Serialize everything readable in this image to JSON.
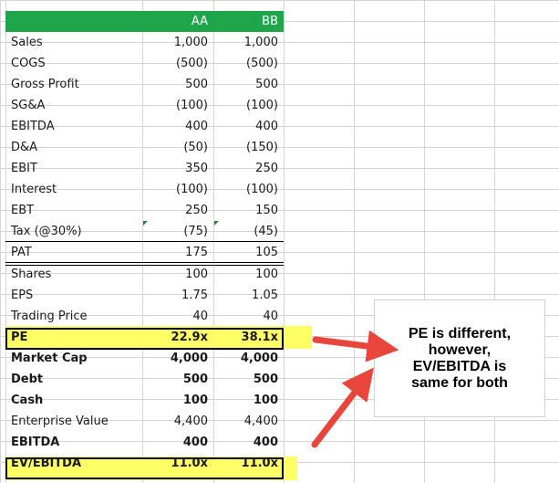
{
  "table": {
    "header": {
      "label": "",
      "aa": "AA",
      "bb": "BB"
    },
    "rows": [
      {
        "label": "Sales",
        "aa": "1,000",
        "bb": "1,000",
        "bold": false
      },
      {
        "label": "COGS",
        "aa": "(500)",
        "bb": "(500)",
        "bold": false
      },
      {
        "label": "Gross Profit",
        "aa": "500",
        "bb": "500",
        "bold": false
      },
      {
        "label": "SG&A",
        "aa": "(100)",
        "bb": "(100)",
        "bold": false
      },
      {
        "label": "EBITDA",
        "aa": "400",
        "bb": "400",
        "bold": false
      },
      {
        "label": "D&A",
        "aa": "(50)",
        "bb": "(150)",
        "bold": false
      },
      {
        "label": "EBIT",
        "aa": "350",
        "bb": "250",
        "bold": false
      },
      {
        "label": "Interest",
        "aa": "(100)",
        "bb": "(100)",
        "bold": false
      },
      {
        "label": "EBT",
        "aa": "250",
        "bb": "150",
        "bold": false
      },
      {
        "label": "Tax (@30%)",
        "aa": "(75)",
        "bb": "(45)",
        "bold": false
      },
      {
        "label": "PAT",
        "aa": "175",
        "bb": "105",
        "bold": false
      },
      {
        "label": "Shares",
        "aa": "100",
        "bb": "100",
        "bold": false
      },
      {
        "label": "EPS",
        "aa": "1.75",
        "bb": "1.05",
        "bold": false
      },
      {
        "label": "Trading Price",
        "aa": "40",
        "bb": "40",
        "bold": false
      },
      {
        "label": "PE",
        "aa": "22.9x",
        "bb": "38.1x",
        "bold": true
      },
      {
        "label": "Market Cap",
        "aa": "4,000",
        "bb": "4,000",
        "bold": true
      },
      {
        "label": "Debt",
        "aa": "500",
        "bb": "500",
        "bold": true
      },
      {
        "label": "Cash",
        "aa": "100",
        "bb": "100",
        "bold": true
      },
      {
        "label": "Enterprise Value",
        "aa": "4,400",
        "bb": "4,400",
        "bold": false
      },
      {
        "label": "EBITDA",
        "aa": "400",
        "bb": "400",
        "bold": true
      },
      {
        "label": "EV/EBITDA",
        "aa": "11.0x",
        "bb": "11.0x",
        "bold": true
      }
    ]
  },
  "callout": {
    "text": "PE is different, however, EV/EBITDA is same for both"
  },
  "colors": {
    "header_bg": "#1fa64a",
    "highlight": "#ffff66",
    "arrow": "#e8463c"
  }
}
